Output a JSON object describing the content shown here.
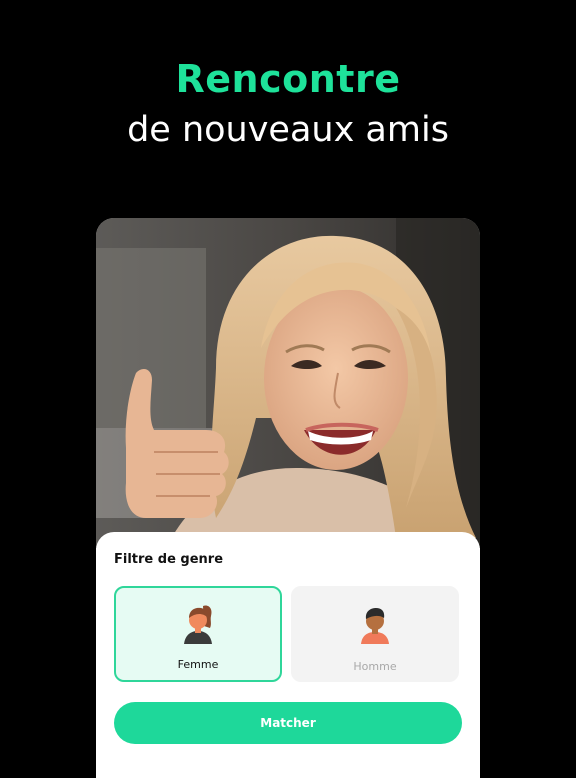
{
  "headline": {
    "line1": "Rencontre",
    "line2": "de nouveaux amis"
  },
  "photo": {
    "icon": "smiling-woman-thumbs-up-photo"
  },
  "gender_filter": {
    "title": "Filtre de genre",
    "options": [
      {
        "label": "Femme",
        "icon": "woman-avatar-icon",
        "selected": true
      },
      {
        "label": "Homme",
        "icon": "man-avatar-icon",
        "selected": false
      }
    ],
    "cta_label": "Matcher"
  },
  "colors": {
    "background": "#000000",
    "accent": "#1ee29a",
    "button": "#1ed89a",
    "selected_bg": "#e6fbf3",
    "unselected_bg": "#f3f3f3"
  }
}
